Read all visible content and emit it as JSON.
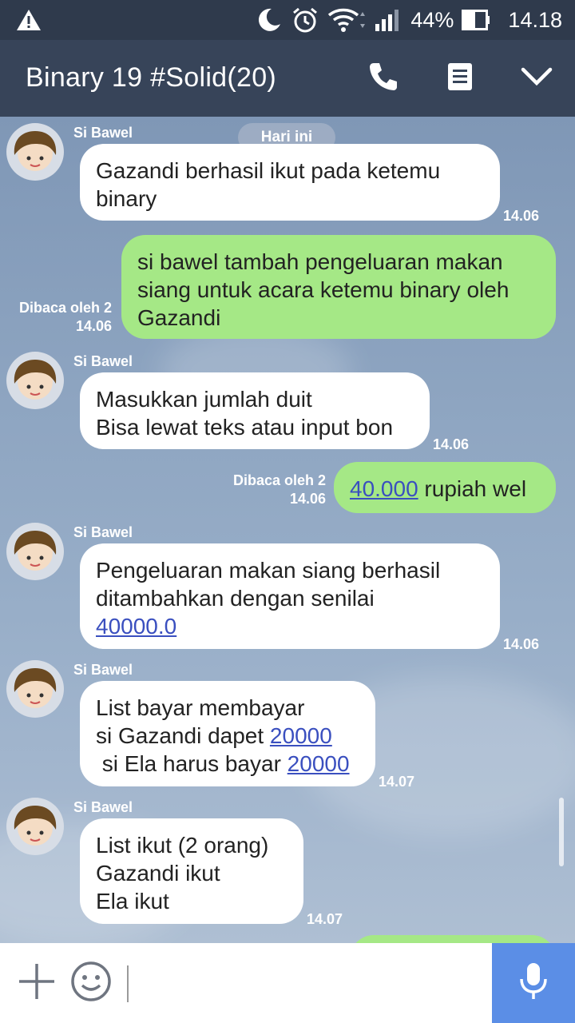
{
  "status_bar": {
    "battery": "44%",
    "time": "14.18"
  },
  "header": {
    "title": "Binary 19 #Solid(20)"
  },
  "day_separator": "Hari ini",
  "messages": [
    {
      "sender": "Si Bawel",
      "lines": [
        [
          "Gazandi berhasil ikut pada ketemu"
        ],
        [
          "binary"
        ]
      ],
      "time": "14.06"
    },
    {
      "read_label": "Dibaca oleh 2",
      "time": "14.06",
      "lines": [
        [
          "si bawel tambah pengeluaran makan"
        ],
        [
          "siang untuk acara ketemu binary oleh"
        ],
        [
          "Gazandi"
        ]
      ]
    },
    {
      "sender": "Si Bawel",
      "lines": [
        [
          "Masukkan jumlah duit"
        ],
        [
          "Bisa lewat teks atau input bon"
        ]
      ],
      "time": "14.06"
    },
    {
      "read_label": "Dibaca oleh 2",
      "time": "14.06",
      "link": "40.000",
      "text": " rupiah wel"
    },
    {
      "sender": "Si Bawel",
      "lines": [
        [
          "Pengeluaran makan siang berhasil"
        ],
        [
          "ditambahkan dengan senilai"
        ]
      ],
      "link": "40000.0",
      "time": "14.06"
    },
    {
      "sender": "Si Bawel",
      "line1": "List bayar membayar",
      "line2_text": "si Gazandi dapet ",
      "line2_link": "20000",
      "line3_text": " si Ela harus bayar ",
      "line3_link": "20000",
      "time": "14.07"
    },
    {
      "sender": "Si Bawel",
      "lines": [
        [
          "List ikut (2 orang)"
        ],
        [
          "Gazandi ikut"
        ],
        [
          "Ela ikut"
        ]
      ],
      "time": "14.07"
    }
  ],
  "icons": {
    "warning": "warning-icon",
    "dnd": "moon-icon",
    "alarm": "alarm-icon",
    "wifi": "wifi-icon",
    "signal": "signal-icon",
    "battery": "battery-icon",
    "call": "phone-icon",
    "notes": "notes-icon",
    "expand": "chevron-down-icon",
    "add": "plus-icon",
    "emoji": "smiley-icon",
    "mic": "mic-icon"
  },
  "colors": {
    "header_bg": "#374459",
    "outgoing_bubble": "#a5e886",
    "incoming_bubble": "#ffffff",
    "link": "#3a4fbf",
    "mic_button": "#5b8ee6"
  }
}
